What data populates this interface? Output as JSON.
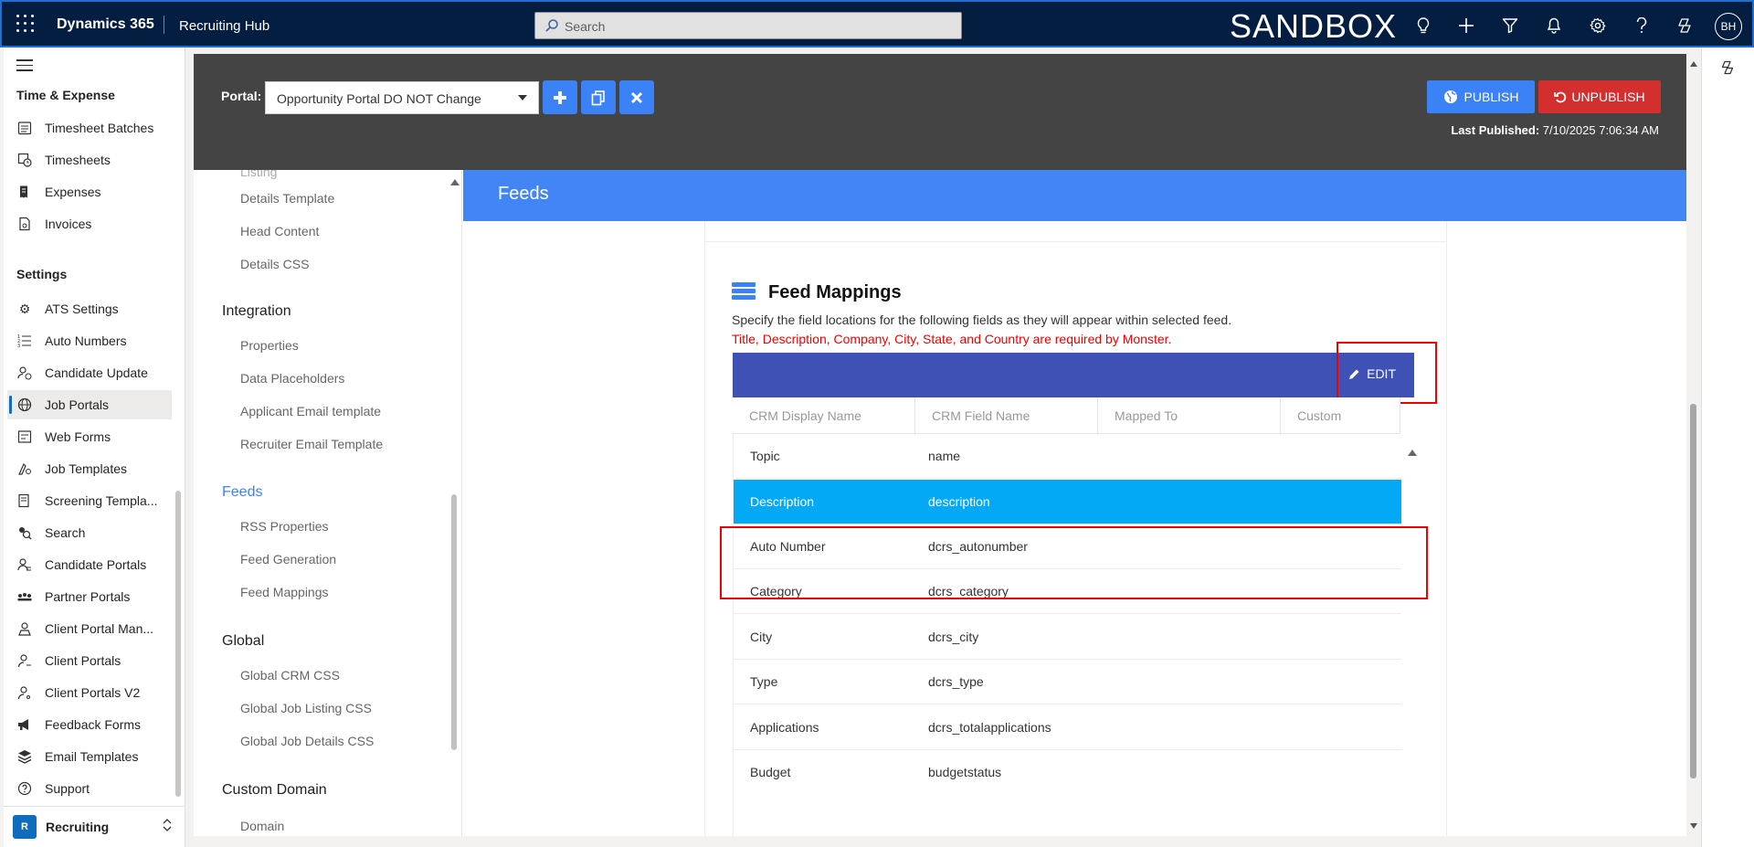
{
  "topbar": {
    "brand": "Dynamics 365",
    "app_name": "Recruiting Hub",
    "search_placeholder": "Search",
    "environment": "SANDBOX",
    "avatar_initials": "BH"
  },
  "sitemap": {
    "sections": [
      {
        "title": "Time & Expense",
        "items": [
          {
            "label": "Timesheet Batches",
            "icon": "calendar-list-icon"
          },
          {
            "label": "Timesheets",
            "icon": "timesheet-icon"
          },
          {
            "label": "Expenses",
            "icon": "receipt-icon"
          },
          {
            "label": "Invoices",
            "icon": "invoice-icon"
          }
        ]
      },
      {
        "title": "Settings",
        "items": [
          {
            "label": "ATS Settings",
            "icon": "gear-icon"
          },
          {
            "label": "Auto Numbers",
            "icon": "numbered-list-icon"
          },
          {
            "label": "Candidate Update",
            "icon": "person-sync-icon"
          },
          {
            "label": "Job Portals",
            "icon": "globe-icon",
            "active": true
          },
          {
            "label": "Web Forms",
            "icon": "form-icon"
          },
          {
            "label": "Job Templates",
            "icon": "template-icon"
          },
          {
            "label": "Screening Templa...",
            "icon": "screening-icon"
          },
          {
            "label": "Search",
            "icon": "search-people-icon"
          },
          {
            "label": "Candidate Portals",
            "icon": "people-icon"
          },
          {
            "label": "Partner Portals",
            "icon": "partners-icon"
          },
          {
            "label": "Client Portal Man...",
            "icon": "person-settings-icon"
          },
          {
            "label": "Client Portals",
            "icon": "person-icon"
          },
          {
            "label": "Client Portals V2",
            "icon": "person-key-icon"
          },
          {
            "label": "Feedback Forms",
            "icon": "megaphone-icon"
          },
          {
            "label": "Email Templates",
            "icon": "stack-icon"
          },
          {
            "label": "Support",
            "icon": "help-circle-icon"
          }
        ]
      }
    ],
    "area": {
      "badge": "R",
      "name": "Recruiting"
    }
  },
  "portal_bar": {
    "label": "Portal:",
    "selected_portal": "Opportunity Portal DO NOT Change",
    "publish_label": "PUBLISH",
    "unpublish_label": "UNPUBLISH",
    "last_published_label": "Last Published:",
    "last_published_value": "7/10/2025 7:06:34 AM"
  },
  "settings_nav": {
    "partial_item": "Listing",
    "groups": [
      {
        "items_before": [
          "Details Template",
          "Head Content",
          "Details CSS"
        ]
      },
      {
        "title": "Integration",
        "items": [
          "Properties",
          "Data Placeholders",
          "Applicant Email template",
          "Recruiter Email Template"
        ]
      },
      {
        "title": "Feeds",
        "active": true,
        "items": [
          "RSS Properties",
          "Feed Generation",
          "Feed Mappings"
        ]
      },
      {
        "title": "Global",
        "items": [
          "Global CRM CSS",
          "Global Job Listing CSS",
          "Global Job Details CSS"
        ]
      },
      {
        "title": "Custom Domain",
        "items": [
          "Domain"
        ]
      }
    ]
  },
  "feeds": {
    "header": "Feeds",
    "title": "Feed Mappings",
    "description": "Specify the field locations for the following fields as they will appear within selected feed.",
    "requirement": "Title, Description, Company, City, State, and Country are required by Monster.",
    "edit_label": "EDIT",
    "columns": [
      "CRM Display Name",
      "CRM Field Name",
      "Mapped To",
      "Custom"
    ],
    "rows": [
      {
        "display": "Topic",
        "field": "name"
      },
      {
        "display": "Description",
        "field": "description",
        "selected": true
      },
      {
        "display": "Auto Number",
        "field": "dcrs_autonumber"
      },
      {
        "display": "Category",
        "field": "dcrs_category"
      },
      {
        "display": "City",
        "field": "dcrs_city"
      },
      {
        "display": "Type",
        "field": "dcrs_type"
      },
      {
        "display": "Applications",
        "field": "dcrs_totalapplications"
      },
      {
        "display": "Budget",
        "field": "budgetstatus"
      }
    ]
  },
  "colors": {
    "topbar": "#041e42",
    "accent_blue": "#3b82f6",
    "feeds_header": "#4285f4",
    "grid_header": "#3f51b5",
    "selected_row": "#03a9f4",
    "unpublish_red": "#d32f2f",
    "highlight_red": "#e00000"
  }
}
